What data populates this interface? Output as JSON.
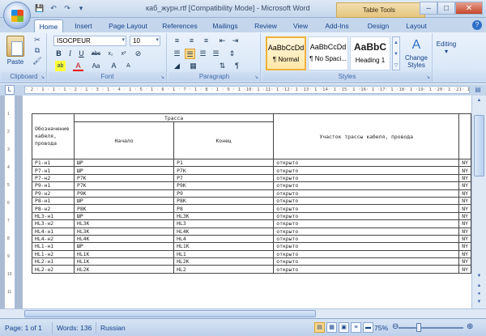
{
  "window": {
    "title": "каб_журн.rtf [Compatibility Mode] - Microsoft Word",
    "context_tab_group": "Table Tools"
  },
  "quick_access": [
    "save-icon",
    "undo-icon",
    "redo-icon",
    "customize-icon"
  ],
  "tabs": [
    {
      "label": "Home",
      "active": true
    },
    {
      "label": "Insert"
    },
    {
      "label": "Page Layout"
    },
    {
      "label": "References"
    },
    {
      "label": "Mailings"
    },
    {
      "label": "Review"
    },
    {
      "label": "View"
    },
    {
      "label": "Add-Ins"
    },
    {
      "label": "Design"
    },
    {
      "label": "Layout"
    }
  ],
  "ribbon": {
    "clipboard": {
      "label": "Clipboard",
      "paste_label": "Paste"
    },
    "font": {
      "label": "Font",
      "font_name": "ISOCPEUR",
      "font_size": "10"
    },
    "paragraph": {
      "label": "Paragraph"
    },
    "styles": {
      "label": "Styles",
      "items": [
        {
          "sample": "AaBbCcDd",
          "name": "¶ Normal",
          "selected": true
        },
        {
          "sample": "AaBbCcDd",
          "name": "¶ No Spaci..."
        },
        {
          "sample": "AaBbC",
          "name": "Heading 1"
        }
      ],
      "change_styles_label": "Change Styles"
    },
    "editing": {
      "label": "Editing"
    }
  },
  "ruler_text": "· 2 · 1 · 1 · 1 · 2 · 1 · 3 · 1 · 4 · 1 · 5 · 1 · 6 · 1 · 7 · 1 · 8 · 1 · 9 · 1 ·10· 1 ·11· 1 ·12· 1 ·13· 1 ·14· 1 ·15· 1 ·16· 1 ·17· 1 ·18· 1 ·19· 1 ·20· 1 ·21· 1 ·22· 1 ·23· 1 ·24· 1 ·25· 1 ·26· 1 ·27· 1 ·28·",
  "vruler_marks": [
    "1",
    "2",
    "3",
    "4",
    "5",
    "6",
    "7",
    "8",
    "9",
    "10",
    "11"
  ],
  "table": {
    "header_col1": "Обозначение кабеля, провода",
    "header_route": "Трасса",
    "header_start": "Начало",
    "header_end": "Конец",
    "header_section": "Участок трассы кабеля, провода",
    "rows": [
      [
        "P1-н1",
        "ШР",
        "P1",
        "открыто",
        "NY"
      ],
      [
        "P7-н1",
        "ШР",
        "P7K",
        "открыто",
        "NY"
      ],
      [
        "P7-н2",
        "P7K",
        "P7",
        "открыто",
        "NY"
      ],
      [
        "P9-н1",
        "P7K",
        "P9K",
        "открыто",
        "NY"
      ],
      [
        "P9-н2",
        "P9K",
        "P9",
        "открыто",
        "NY"
      ],
      [
        "P8-н1",
        "ШР",
        "P8K",
        "открыто",
        "NY"
      ],
      [
        "P8-н2",
        "P8K",
        "P8",
        "открыто",
        "NY"
      ],
      [
        "HL3-н1",
        "ШР",
        "HL3K",
        "открыто",
        "NY"
      ],
      [
        "HL3-н2",
        "HL3K",
        "HL3",
        "открыто",
        "NY"
      ],
      [
        "HL4-н1",
        "HL3K",
        "HL4K",
        "открыто",
        "NY"
      ],
      [
        "HL4-н2",
        "HL4K",
        "HL4",
        "открыто",
        "NY"
      ],
      [
        "HL1-н1",
        "ШР",
        "HL1K",
        "открыто",
        "NY"
      ],
      [
        "HL1-н2",
        "HL1K",
        "HL1",
        "открыто",
        "NY"
      ],
      [
        "HL2-н1",
        "HL1K",
        "HL2K",
        "открыто",
        "NY"
      ],
      [
        "HL2-н2",
        "HL2K",
        "HL2",
        "открыто",
        "NY"
      ]
    ]
  },
  "status": {
    "page": "Page: 1 of 1",
    "words": "Words: 136",
    "language": "Russian",
    "zoom": "75%"
  }
}
